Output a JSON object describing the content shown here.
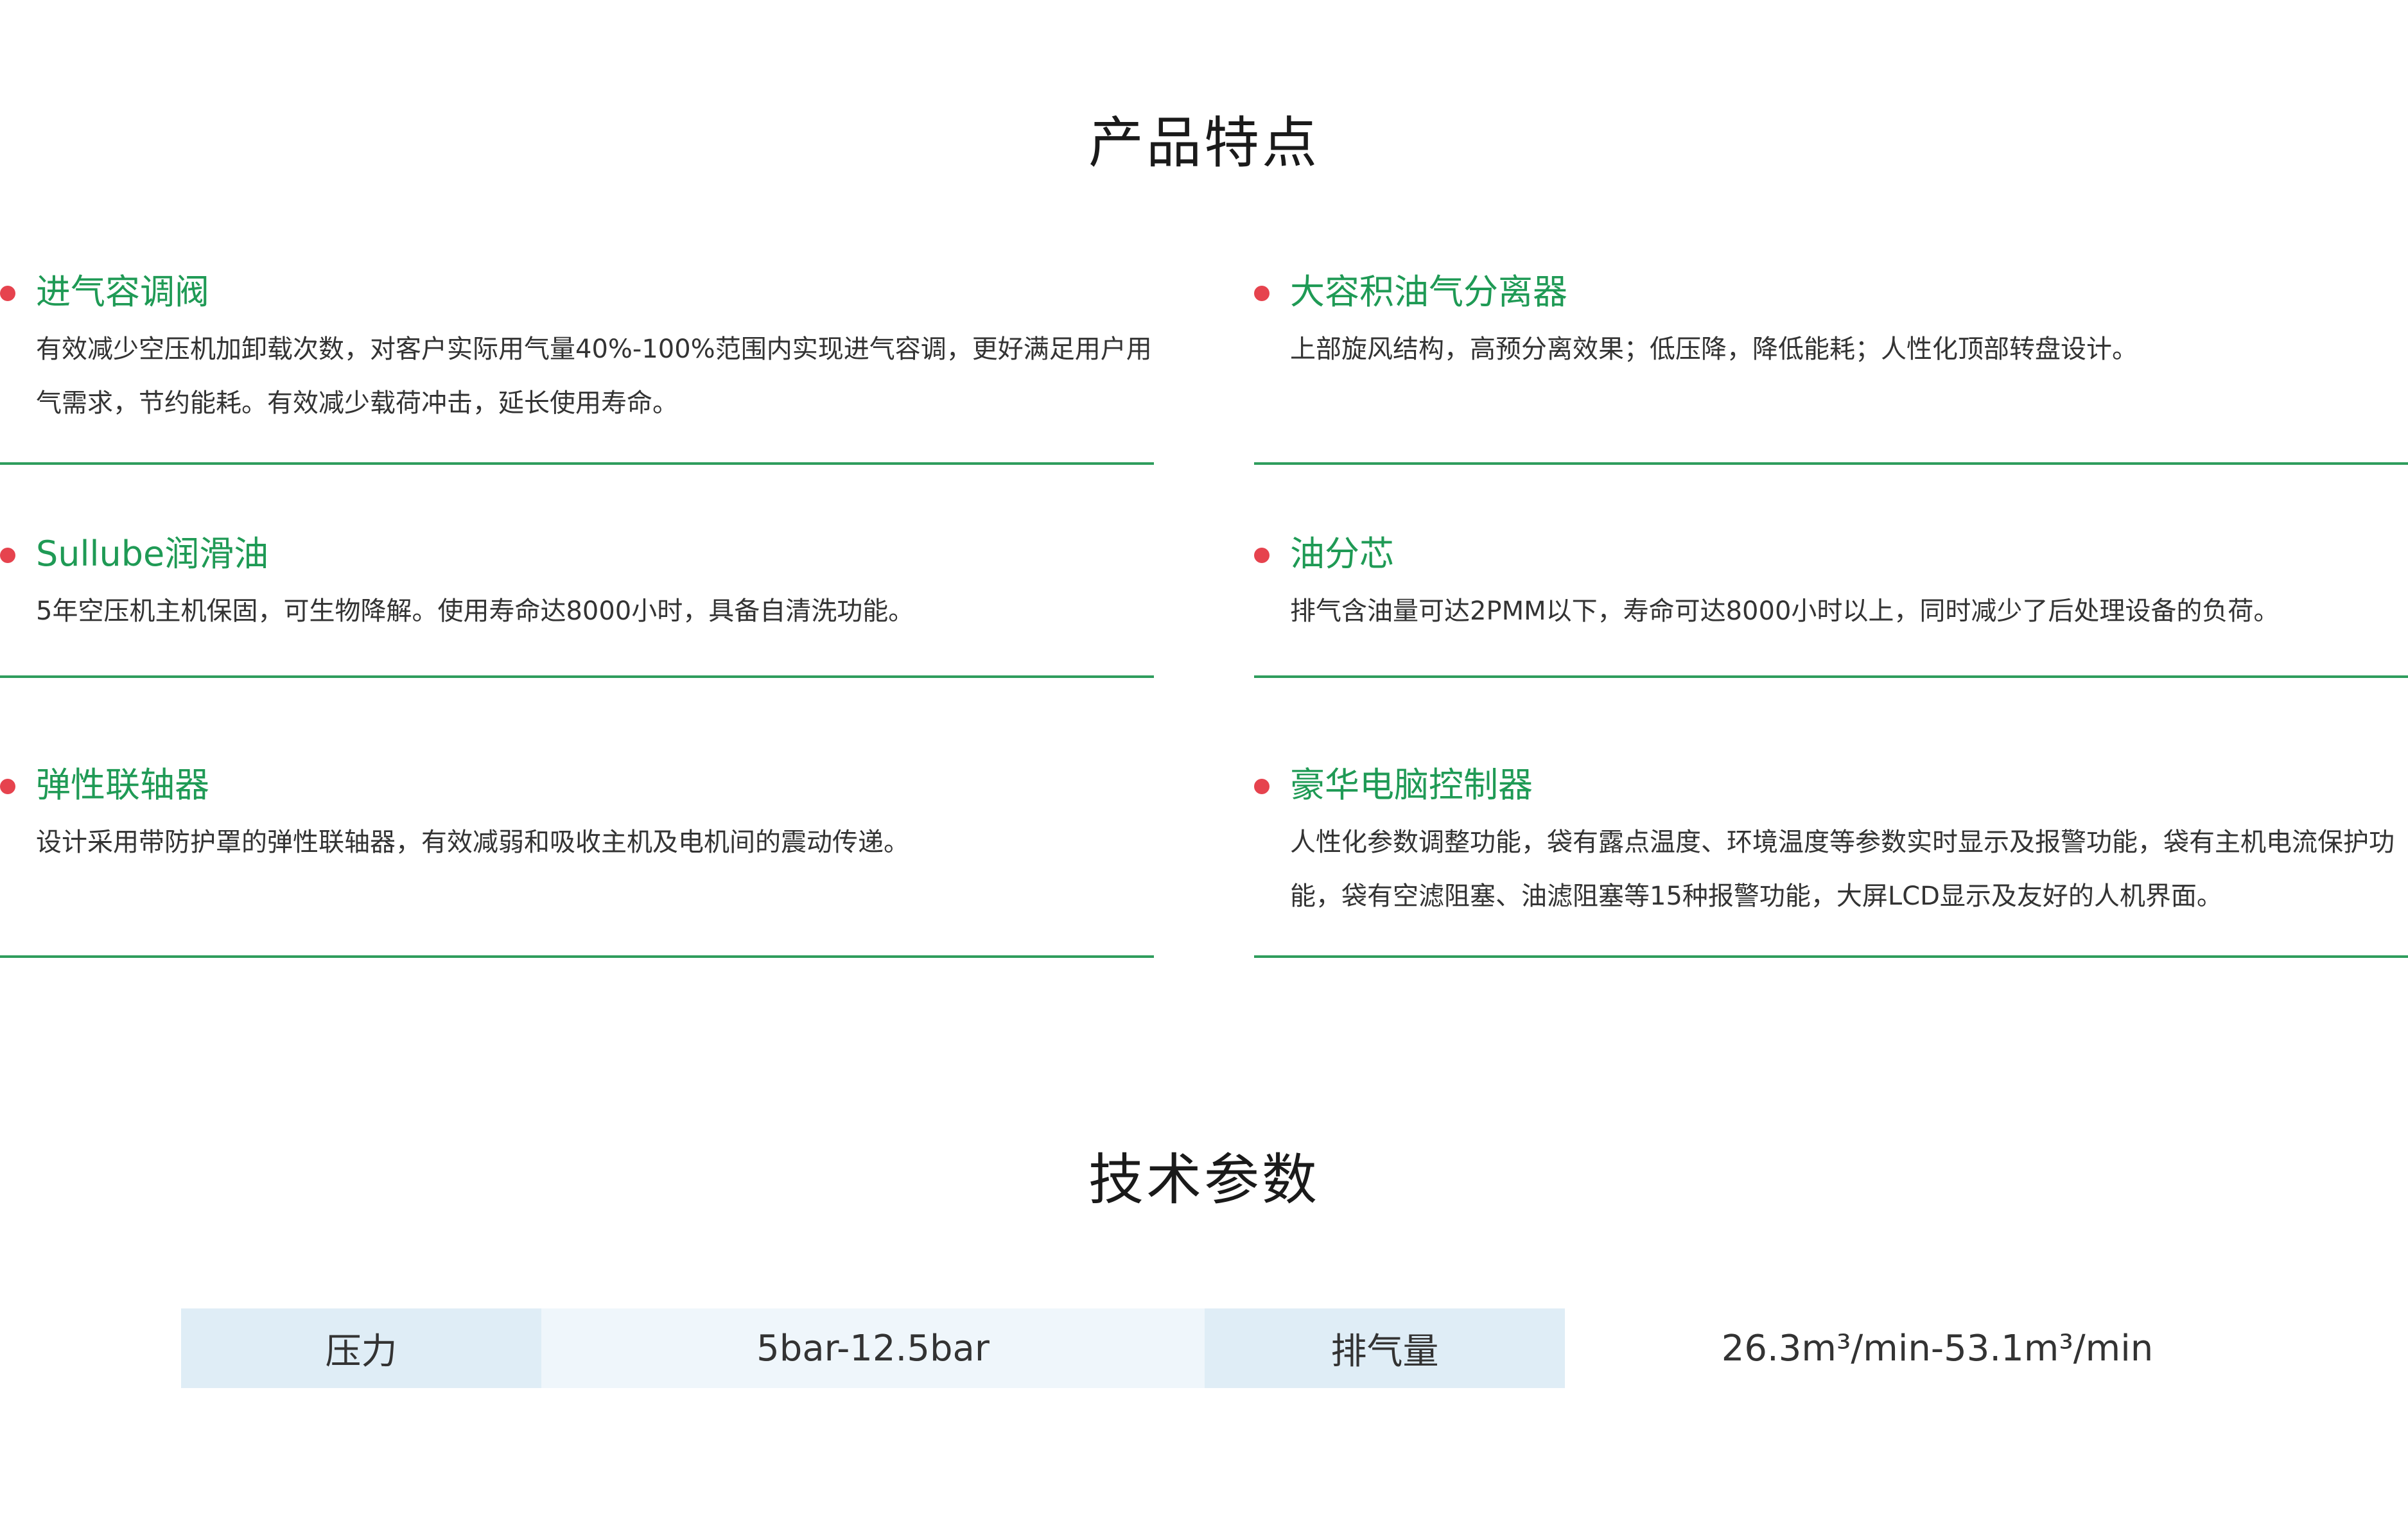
{
  "features_section": {
    "title": "产品特点",
    "items": [
      {
        "title": "进气容调阀",
        "description": "有效减少空压机加卸载次数，对客户实际用气量40%-100%范围内实现进气容调，更好满足用户用气需求，节约能耗。有效减少载荷冲击，延长使用寿命。"
      },
      {
        "title": "大容积油气分离器",
        "description": "上部旋风结构，高预分离效果；低压降，降低能耗；人性化顶部转盘设计。"
      },
      {
        "title": "Sullube润滑油",
        "description": "5年空压机主机保固，可生物降解。使用寿命达8000小时，具备自清洗功能。"
      },
      {
        "title": "油分芯",
        "description": "排气含油量可达2PMM以下，寿命可达8000小时以上，同时减少了后处理设备的负荷。"
      },
      {
        "title": "弹性联轴器",
        "description": "设计采用带防护罩的弹性联轴器，有效减弱和吸收主机及电机间的震动传递。"
      },
      {
        "title": "豪华电脑控制器",
        "description": "人性化参数调整功能，袋有露点温度、环境温度等参数实时显示及报警功能，袋有主机电流保护功能，袋有空滤阻塞、油滤阻塞等15种报警功能，大屏LCD显示及友好的人机界面。"
      }
    ]
  },
  "params_section": {
    "title": "技术参数",
    "rows": [
      {
        "label1": "压力",
        "value1": "5bar-12.5bar",
        "label2": "排气量",
        "value2": "26.3m³/min-53.1m³/min"
      }
    ]
  },
  "colors": {
    "accent_green": "#1f9a55",
    "divider_green": "#2f9d5d",
    "bullet_red": "#e6434e",
    "label_bg": "#dfedf6",
    "value_bg": "#eff6fb"
  }
}
